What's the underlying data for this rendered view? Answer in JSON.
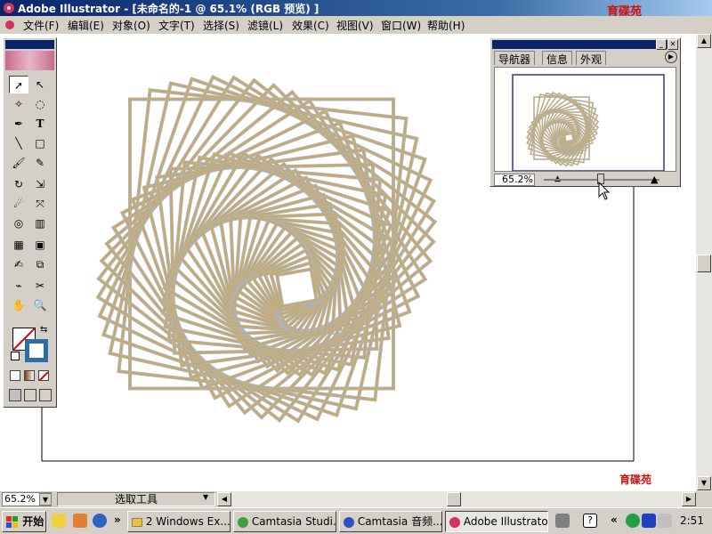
{
  "window": {
    "title": "Adobe Illustrator - [未命名的-1 @ 65.1% (RGB 预览) ]",
    "minimize_label": "_",
    "maximize_label": "□",
    "close_label": "✕"
  },
  "logo": {
    "text": "育碟苑"
  },
  "menu": {
    "items": [
      "文件(F)",
      "编辑(E)",
      "对象(O)",
      "文字(T)",
      "选择(S)",
      "滤镜(L)",
      "效果(C)",
      "视图(V)",
      "窗口(W)",
      "帮助(H)"
    ]
  },
  "toolbox": {
    "tools": [
      "selection-tool",
      "direct-selection-tool",
      "magic-wand-tool",
      "lasso-tool",
      "pen-tool",
      "type-tool",
      "line-tool",
      "rectangle-tool",
      "paintbrush-tool",
      "pencil-tool",
      "rotate-tool",
      "scale-tool",
      "warp-tool",
      "free-transform-tool",
      "symbol-sprayer-tool",
      "graph-tool",
      "mesh-tool",
      "gradient-tool",
      "eyedropper-tool",
      "blend-tool",
      "slice-tool",
      "scissors-tool",
      "hand-tool",
      "zoom-tool"
    ],
    "type_glyph": "T"
  },
  "navigator": {
    "tabs": [
      "导航器",
      "信息",
      "外观"
    ],
    "zoom": "65.2%"
  },
  "status": {
    "zoom": "65.2%",
    "current_tool": "选取工具"
  },
  "taskbar": {
    "start_label": "开始",
    "overflow_label": "»",
    "tray_overflow_label": "«",
    "help_glyph": "?",
    "buttons": [
      {
        "label": "2 Windows Ex...",
        "active": false
      },
      {
        "label": "Camtasia Studi...",
        "active": false
      },
      {
        "label": "Camtasia 音频...",
        "active": false
      },
      {
        "label": "Adobe Illustrato...",
        "active": true
      }
    ],
    "clock": "2:51"
  },
  "colors": {
    "stroke_outer": "#a8b4c8",
    "stroke_inner": "#d4a84a",
    "titlebar": "#0a246a"
  }
}
